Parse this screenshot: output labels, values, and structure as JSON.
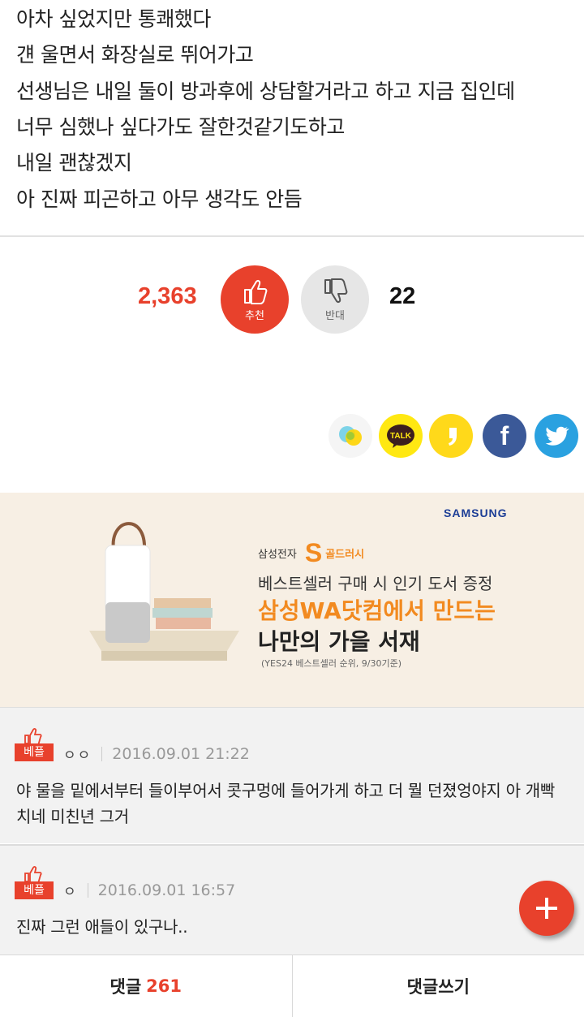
{
  "article": {
    "lines": [
      "아차 싶었지만 통쾌했다",
      "걘 울면서 화장실로 뛰어가고",
      "선생님은 내일 둘이 방과후에 상담할거라고 하고 지금 집인데",
      "너무 심했나 싶다가도 잘한것같기도하고",
      "내일 괜찮겠지",
      "아 진짜 피곤하고 아무 생각도 안듬"
    ]
  },
  "vote": {
    "up_count": "2,363",
    "up_label": "추천",
    "down_label": "반대",
    "down_count": "22",
    "up_color": "#e8412c"
  },
  "share": {
    "icons": [
      "kakao-story-icon",
      "kakao-talk-icon",
      "kakao-talk-channel-icon",
      "facebook-icon",
      "twitter-icon"
    ],
    "talk_label": "TALK",
    "facebook_letter": "f"
  },
  "ad": {
    "brand": "SAMSUNG",
    "sub_brand": "삼성전자",
    "s_logo": "S",
    "sub_brand_tag": "골드러시",
    "line1": "베스트셀러 구매 시 인기 도서 증정",
    "line2": "삼성WA닷컴에서 만드는",
    "line3": "나만의 가을 서재",
    "line4": "(YES24 베스트셀러 순위, 9/30기준)"
  },
  "comments": [
    {
      "badge": "베플",
      "nick": "ㅇㅇ",
      "time": "2016.09.01 21:22",
      "body": "야 물을 밑에서부터 들이부어서 콧구멍에 들어가게 하고 더 뭘 던졌엉야지 아 개빡치네 미친년 그거"
    },
    {
      "badge": "베플",
      "nick": "ㅇ",
      "time": "2016.09.01 16:57",
      "body": "진짜 그런 애들이 있구나.."
    }
  ],
  "bottom_bar": {
    "comments_label": "댓글",
    "comments_count": "261",
    "write_label": "댓글쓰기"
  },
  "colors": {
    "accent": "#e8412c",
    "ad_orange": "#f28a20",
    "samsung_blue": "#1d3e96",
    "facebook": "#3b5998",
    "twitter": "#2aa1e0",
    "kakao_yellow": "#ffe812"
  }
}
